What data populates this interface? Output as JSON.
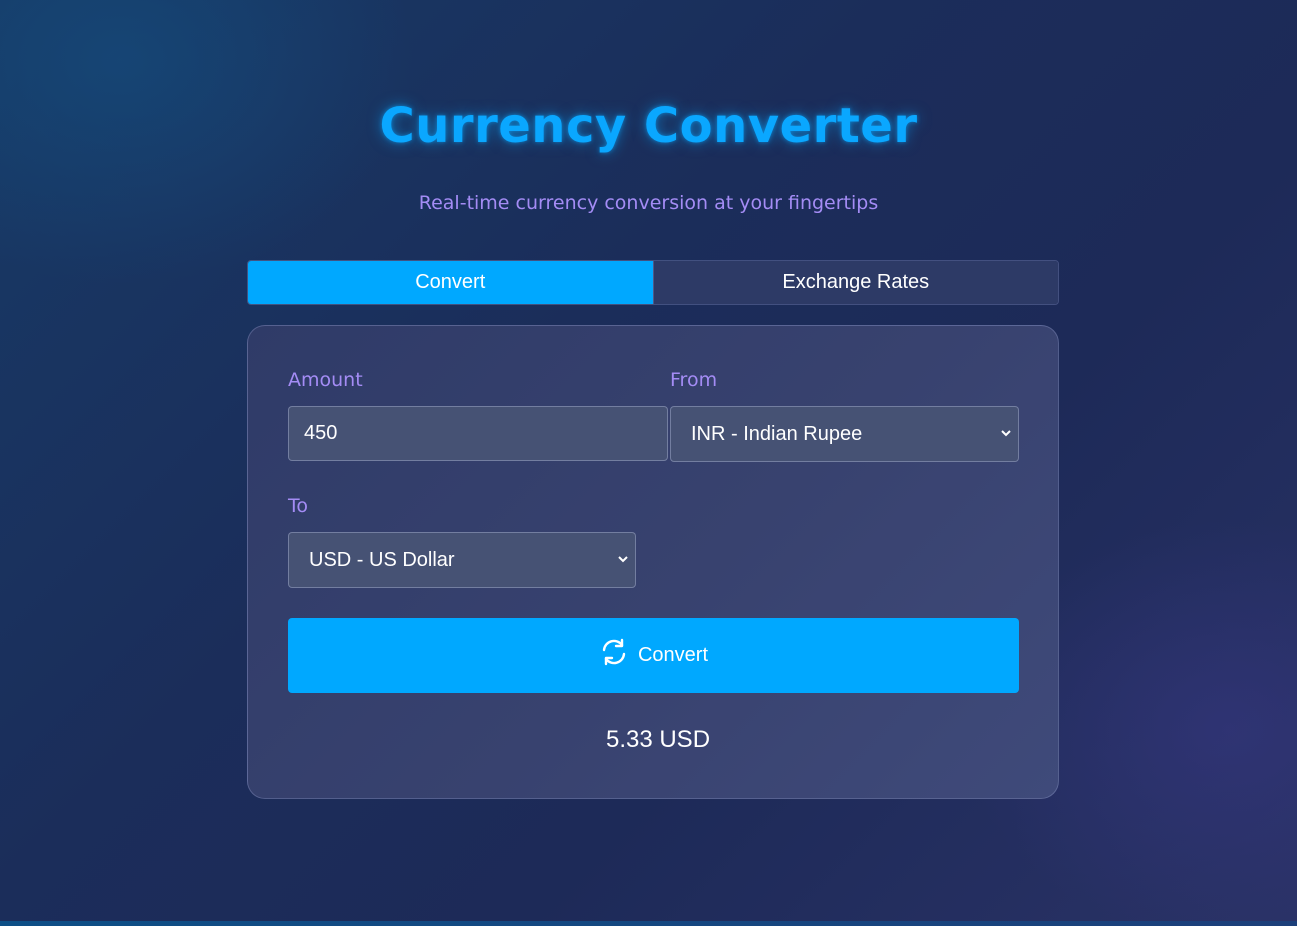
{
  "header": {
    "title": "Currency Converter",
    "subtitle": "Real-time currency conversion at your fingertips"
  },
  "tabs": [
    {
      "label": "Convert",
      "active": true
    },
    {
      "label": "Exchange Rates",
      "active": false
    }
  ],
  "form": {
    "amount": {
      "label": "Amount",
      "value": "450"
    },
    "from": {
      "label": "From",
      "selected": "INR - Indian Rupee"
    },
    "to": {
      "label": "To",
      "selected": "USD - US Dollar"
    },
    "convert_button": {
      "label": "Convert",
      "icon": "refresh-icon"
    }
  },
  "result": "5.33 USD",
  "colors": {
    "accent": "#00a8ff",
    "label": "#a48cf5",
    "card": "#38426f"
  }
}
